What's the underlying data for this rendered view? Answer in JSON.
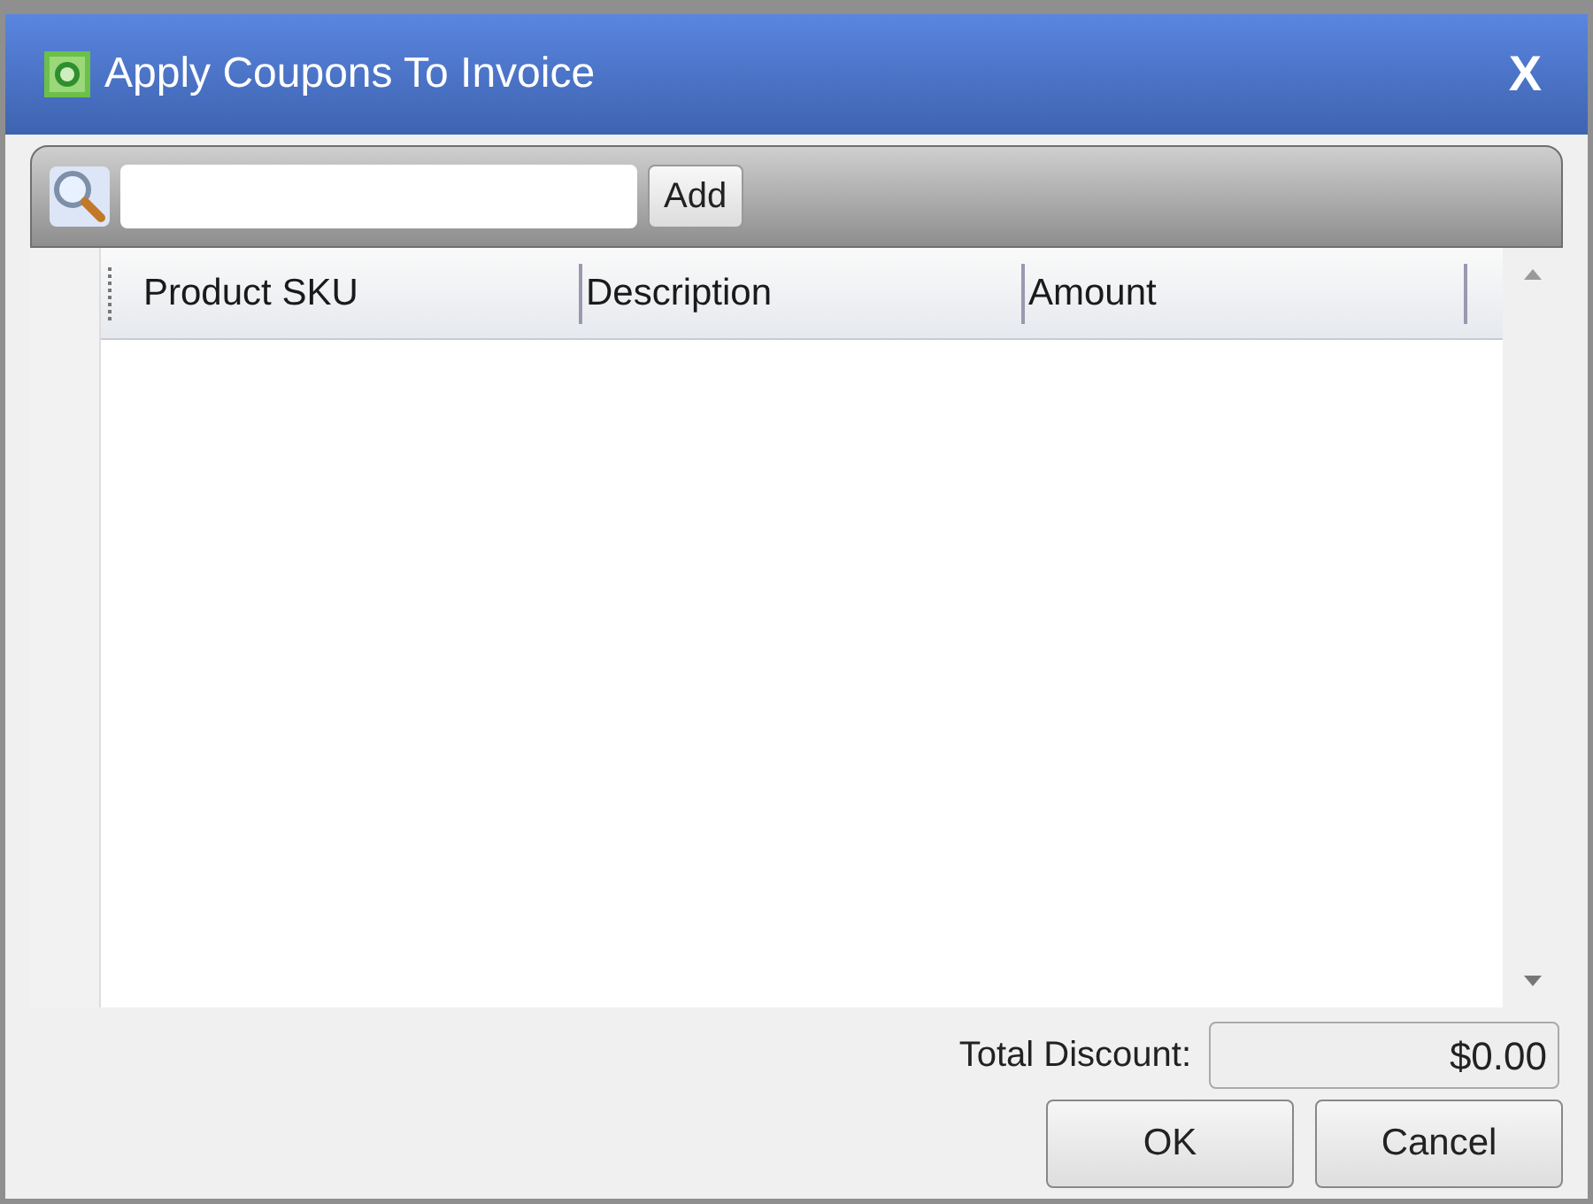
{
  "window": {
    "title": "Apply Coupons To Invoice",
    "close": "X"
  },
  "toolbar": {
    "add_button": "Add"
  },
  "table": {
    "columns": [
      "Product SKU",
      "Description",
      "Amount"
    ]
  },
  "total": {
    "label": "Total Discount:",
    "value": "$0.00"
  },
  "buttons": [
    "OK",
    "Cancel"
  ]
}
